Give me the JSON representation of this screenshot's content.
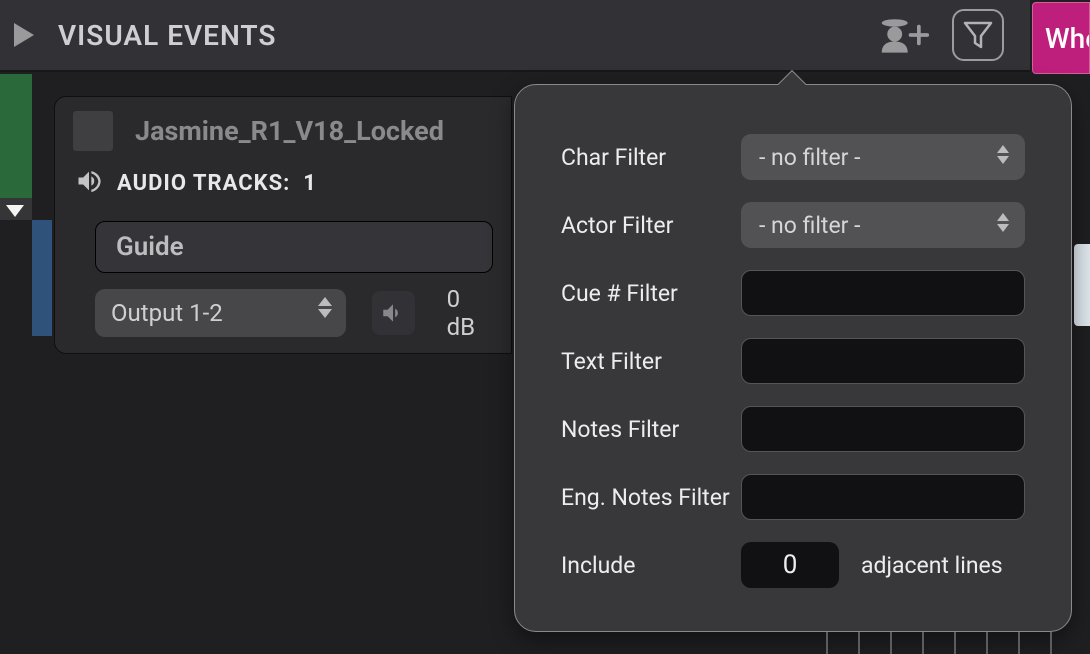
{
  "header": {
    "title": "VISUAL EVENTS",
    "pink_button_label": "Whe"
  },
  "project": {
    "name": "Jasmine_R1_V18_Locked"
  },
  "audio_tracks": {
    "label": "AUDIO TRACKS:",
    "count": "1"
  },
  "guide": {
    "label": "Guide"
  },
  "output": {
    "selected": "Output 1-2",
    "level_text": "0 dB"
  },
  "filters": {
    "char_label": "Char Filter",
    "char_value": "- no filter -",
    "actor_label": "Actor Filter",
    "actor_value": "- no filter -",
    "cue_label": "Cue # Filter",
    "cue_value": "",
    "text_label": "Text Filter",
    "text_value": "",
    "notes_label": "Notes Filter",
    "notes_value": "",
    "eng_notes_label": "Eng. Notes Filter",
    "eng_notes_value": "",
    "include_label": "Include",
    "include_value": "0",
    "include_suffix": "adjacent lines"
  }
}
